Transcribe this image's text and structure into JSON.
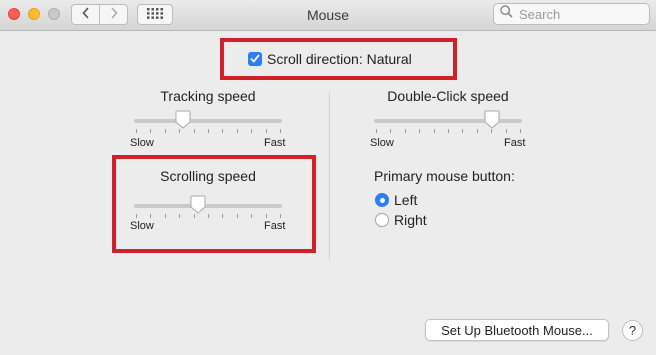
{
  "window": {
    "title": "Mouse"
  },
  "search": {
    "placeholder": "Search"
  },
  "scroll_direction": {
    "label": "Scroll direction: Natural",
    "checked": true
  },
  "tracking_speed": {
    "title": "Tracking speed",
    "min_label": "Slow",
    "max_label": "Fast",
    "level": 0.33
  },
  "double_click_speed": {
    "title": "Double-Click speed",
    "min_label": "Slow",
    "max_label": "Fast",
    "level": 0.8
  },
  "scrolling_speed": {
    "title": "Scrolling speed",
    "min_label": "Slow",
    "max_label": "Fast",
    "level": 0.43
  },
  "primary_button": {
    "title": "Primary mouse button:",
    "options": [
      {
        "label": "Left",
        "selected": true
      },
      {
        "label": "Right",
        "selected": false
      }
    ]
  },
  "footer": {
    "bluetooth_label": "Set Up Bluetooth Mouse...",
    "help_label": "?"
  },
  "colors": {
    "accent": "#2b7ef6",
    "highlight": "#d0202c"
  },
  "icons": [
    "chevron-left-icon",
    "chevron-right-icon",
    "grid-icon",
    "search-icon",
    "checkmark-icon"
  ]
}
